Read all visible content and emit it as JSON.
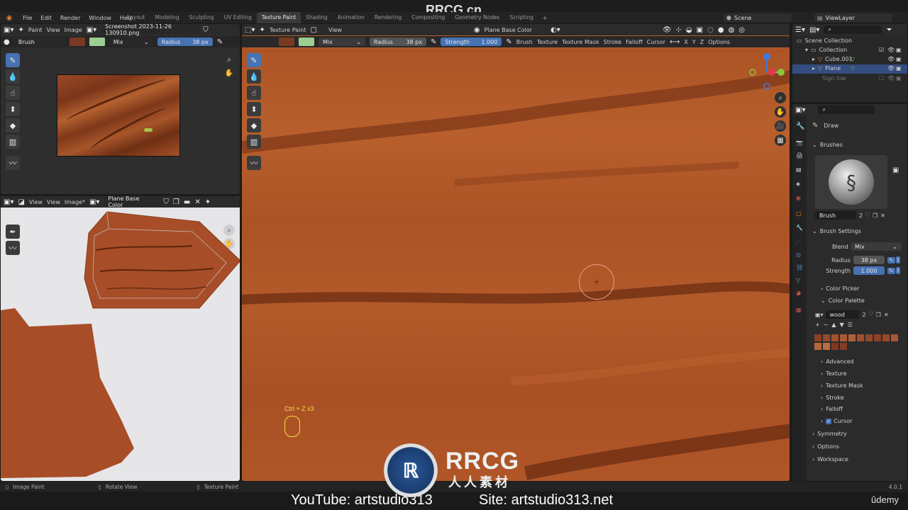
{
  "menu": {
    "items": [
      "File",
      "Edit",
      "Render",
      "Window",
      "Help"
    ]
  },
  "workspaces": {
    "tabs": [
      "Layout",
      "Modeling",
      "Sculpting",
      "UV Editing",
      "Texture Paint",
      "Shading",
      "Animation",
      "Rendering",
      "Compositing",
      "Geometry Nodes",
      "Scripting"
    ],
    "active": "Texture Paint",
    "add": "+"
  },
  "scene": {
    "name": "Scene",
    "view_layer": "ViewLayer"
  },
  "left_editor": {
    "mode": "Paint",
    "view": "View",
    "image": "Image",
    "image_name": "Screenshot 2023-11-26 130910.png",
    "brush_label": "Brush",
    "blend": "Mix",
    "radius_label": "Radius",
    "radius_value": "38 px",
    "color_a": "#7a3a22",
    "color_b": "#9ccf8f"
  },
  "uv_editor": {
    "view_a": "View",
    "view_b": "View",
    "image": "Image*",
    "image_name": "Plane Base Color"
  },
  "viewport": {
    "mode": "Texture Paint",
    "view": "View",
    "bake": "Plane Base Color",
    "blend": "Mix",
    "radius_label": "Radius",
    "radius_value": "38 px",
    "strength_label": "Strength",
    "strength_value": "1.000",
    "menus": [
      "Brush",
      "Texture",
      "Texture Mask",
      "Stroke",
      "Falloff",
      "Cursor"
    ],
    "axes": [
      "X",
      "Y",
      "Z"
    ],
    "options": "Options",
    "shortcut": "Ctrl + Z x3",
    "color_a": "#7a3a22",
    "color_b": "#9ccf8f"
  },
  "outliner": {
    "items": [
      {
        "label": "Scene Collection"
      },
      {
        "label": "Collection"
      },
      {
        "label": "Cube.001"
      },
      {
        "label": "Plane"
      },
      {
        "label": "Sign low"
      }
    ]
  },
  "properties": {
    "tool": "Draw",
    "brushes": "Brushes",
    "brush_name": "Brush",
    "brush_users": "2",
    "brush_settings": "Brush Settings",
    "blend_label": "Blend",
    "blend_value": "Mix",
    "radius_label": "Radius",
    "radius_value": "38 px",
    "strength_label": "Strength",
    "strength_value": "1.000",
    "color_picker": "Color Picker",
    "color_palette": "Color Palette",
    "palette_name": "wood",
    "palette_users": "2",
    "palette_colors": [
      "#8a3e22",
      "#96492a",
      "#a0522e",
      "#a85a34",
      "#b0603a",
      "#a24e2c",
      "#94452a",
      "#8c4226",
      "#9a4a2b",
      "#a65633",
      "#b46838",
      "#ba6e3e",
      "#7e3820",
      "#873c24"
    ],
    "sections": [
      "Advanced",
      "Texture",
      "Texture Mask",
      "Stroke",
      "Falloff",
      "Cursor"
    ],
    "symmetry": "Symmetry",
    "options": "Options",
    "workspace": "Workspace"
  },
  "status": {
    "left": "Image Paint",
    "middle": "Rotate View",
    "right": "Texture Paint",
    "version": "4.0.1"
  },
  "watermark": {
    "brand": "RRCG",
    "sub": "人人素材",
    "top": "RRCG.cn",
    "youtube": "YouTube: artstudio313",
    "site": "Site: artstudio313.net",
    "udemy": "ûdemy"
  }
}
